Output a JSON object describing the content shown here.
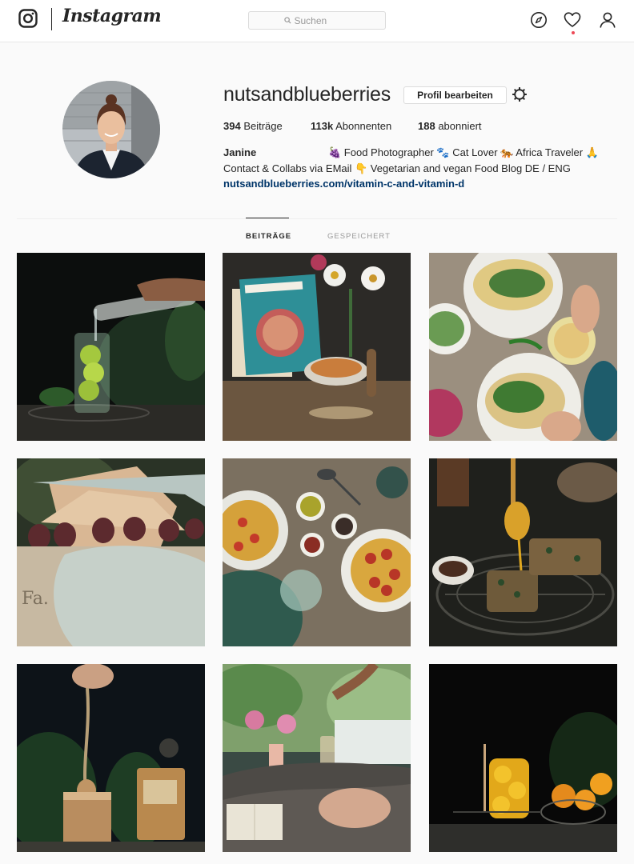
{
  "nav": {
    "brand": "Instagram",
    "search_placeholder": "Suchen",
    "icons": [
      "instagram-glyph-icon",
      "search-icon",
      "compass-icon",
      "heart-icon",
      "profile-icon"
    ]
  },
  "profile": {
    "username": "nutsandblueberries",
    "edit_button": "Profil bearbeiten",
    "stats": {
      "posts_count": "394",
      "posts_label": "Beiträge",
      "followers_count": "113k",
      "followers_label": "Abonnenten",
      "following_count": "188",
      "following_label": "abonniert"
    },
    "name": "Janine",
    "bio_line1": "🍇 Food Photographer 🐾 Cat Lover 🐅 Africa Traveler 🙏",
    "bio_line2": "Contact & Collabs via EMail 👇 Vegetarian and vegan Food Blog DE / ENG",
    "website": "nutsandblueberries.com/vitamin-c-and-vitamin-d"
  },
  "tabs": [
    {
      "label": "BEITRÄGE",
      "active": true
    },
    {
      "label": "GESPEICHERT",
      "active": false
    }
  ],
  "posts": [
    {
      "subject": "water-pouring-into-lime-jar"
    },
    {
      "subject": "tierschutz-cookbook-with-bowl"
    },
    {
      "subject": "tortilla-wraps-with-hummus"
    },
    {
      "subject": "sandwich-cookies-in-paper"
    },
    {
      "subject": "pasta-with-meatballs-and-oil"
    },
    {
      "subject": "honey-dipper-and-granola-bars"
    },
    {
      "subject": "spoon-of-nut-butter-and-grinder"
    },
    {
      "subject": "flowers-and-tea-by-window"
    },
    {
      "subject": "lemon-jar-and-oranges"
    }
  ],
  "colors": {
    "accent": "#003569",
    "notification": "#ed4956",
    "text": "#262626",
    "muted": "#999999",
    "background": "#fafafa"
  }
}
